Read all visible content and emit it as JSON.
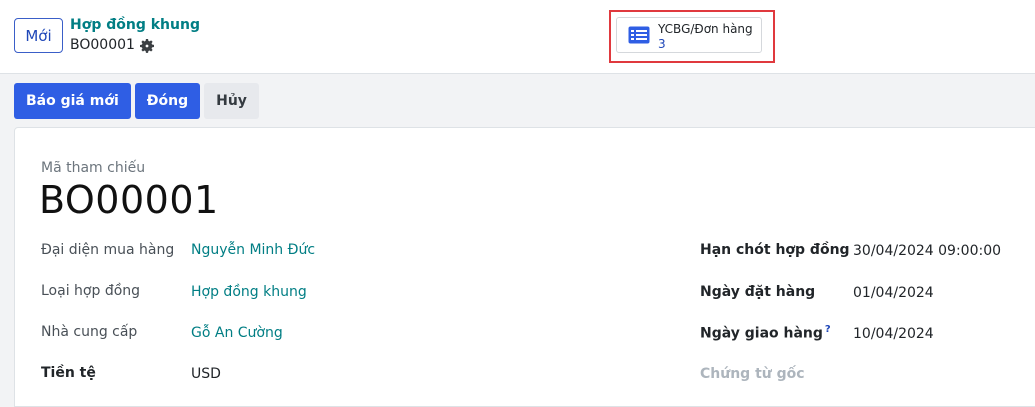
{
  "header": {
    "new_button": "Mới",
    "breadcrumb_parent": "Hợp đồng khung",
    "breadcrumb_current": "BO00001"
  },
  "smart_button": {
    "label": "YCBG/Đơn hàng",
    "count": "3",
    "icon": "list-icon"
  },
  "actions": {
    "new_quotation": "Báo giá mới",
    "close": "Đóng",
    "cancel": "Hủy"
  },
  "form": {
    "reference_label": "Mã tham chiếu",
    "reference_value": "BO00001",
    "left_fields": [
      {
        "label": "Đại diện mua hàng",
        "value": "Nguyễn Minh Đức"
      },
      {
        "label": "Loại hợp đồng",
        "value": "Hợp đồng khung"
      },
      {
        "label": "Nhà cung cấp",
        "value": "Gỗ An Cường"
      },
      {
        "label": "Tiền tệ",
        "value": "USD"
      }
    ],
    "right_fields": [
      {
        "label": "Hạn chót hợp đồng",
        "value": "30/04/2024 09:00:00"
      },
      {
        "label": "Ngày đặt hàng",
        "value": "01/04/2024"
      },
      {
        "label": "Ngày giao hàng",
        "help": "?",
        "value": "10/04/2024"
      },
      {
        "label": "Chứng từ gốc",
        "value": ""
      }
    ]
  },
  "colors": {
    "primary": "#2f5ee4",
    "link_teal": "#017e84",
    "highlight": "#e0393e"
  }
}
